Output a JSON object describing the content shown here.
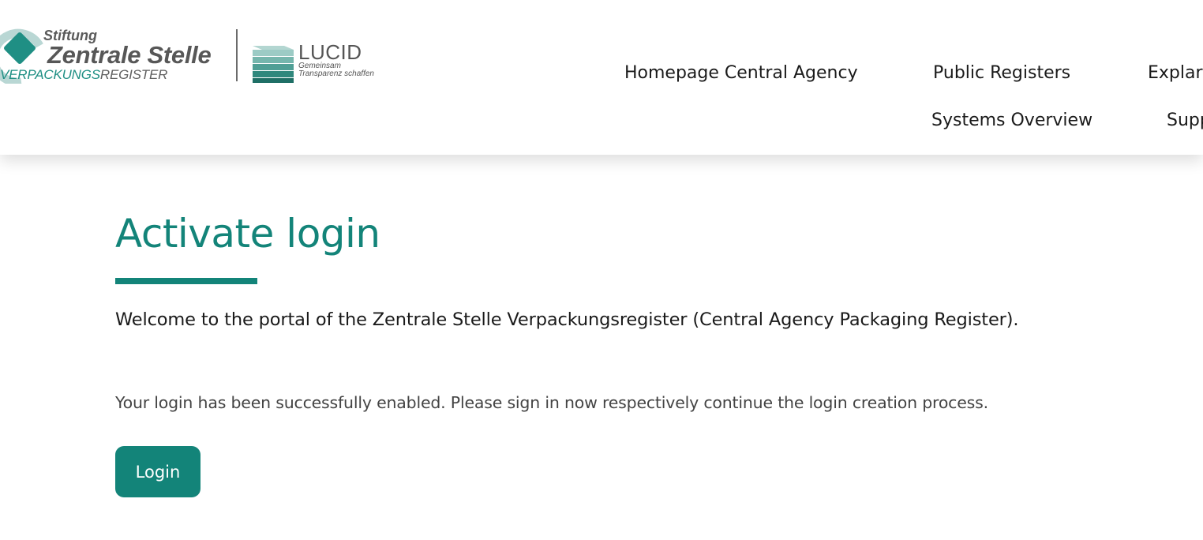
{
  "brand": {
    "zsvr": {
      "line1": "Stiftung",
      "line2": "Zentrale Stelle",
      "line3_part1": "VERPACKUNGS",
      "line3_part2": "REGISTER"
    },
    "lucid": {
      "title": "LUCID",
      "tagline1": "Gemeinsam",
      "tagline2": "Transparenz schaffen"
    }
  },
  "nav": {
    "homepage": "Homepage Central Agency",
    "public_registers": "Public Registers",
    "explanations": "Explar",
    "systems_overview": "Systems Overview",
    "support": "Supp"
  },
  "main": {
    "title": "Activate login",
    "welcome": "Welcome to the portal of the Zentrale Stelle Verpackungsregister (Central Agency Packaging Register).",
    "status": "Your login has been successfully enabled. Please sign in now respectively continue the login creation process.",
    "login_label": "Login"
  },
  "colors": {
    "accent": "#138479",
    "logo_teal": "#1f8f84",
    "text": "#1a1a1a",
    "muted_text": "#444444"
  }
}
